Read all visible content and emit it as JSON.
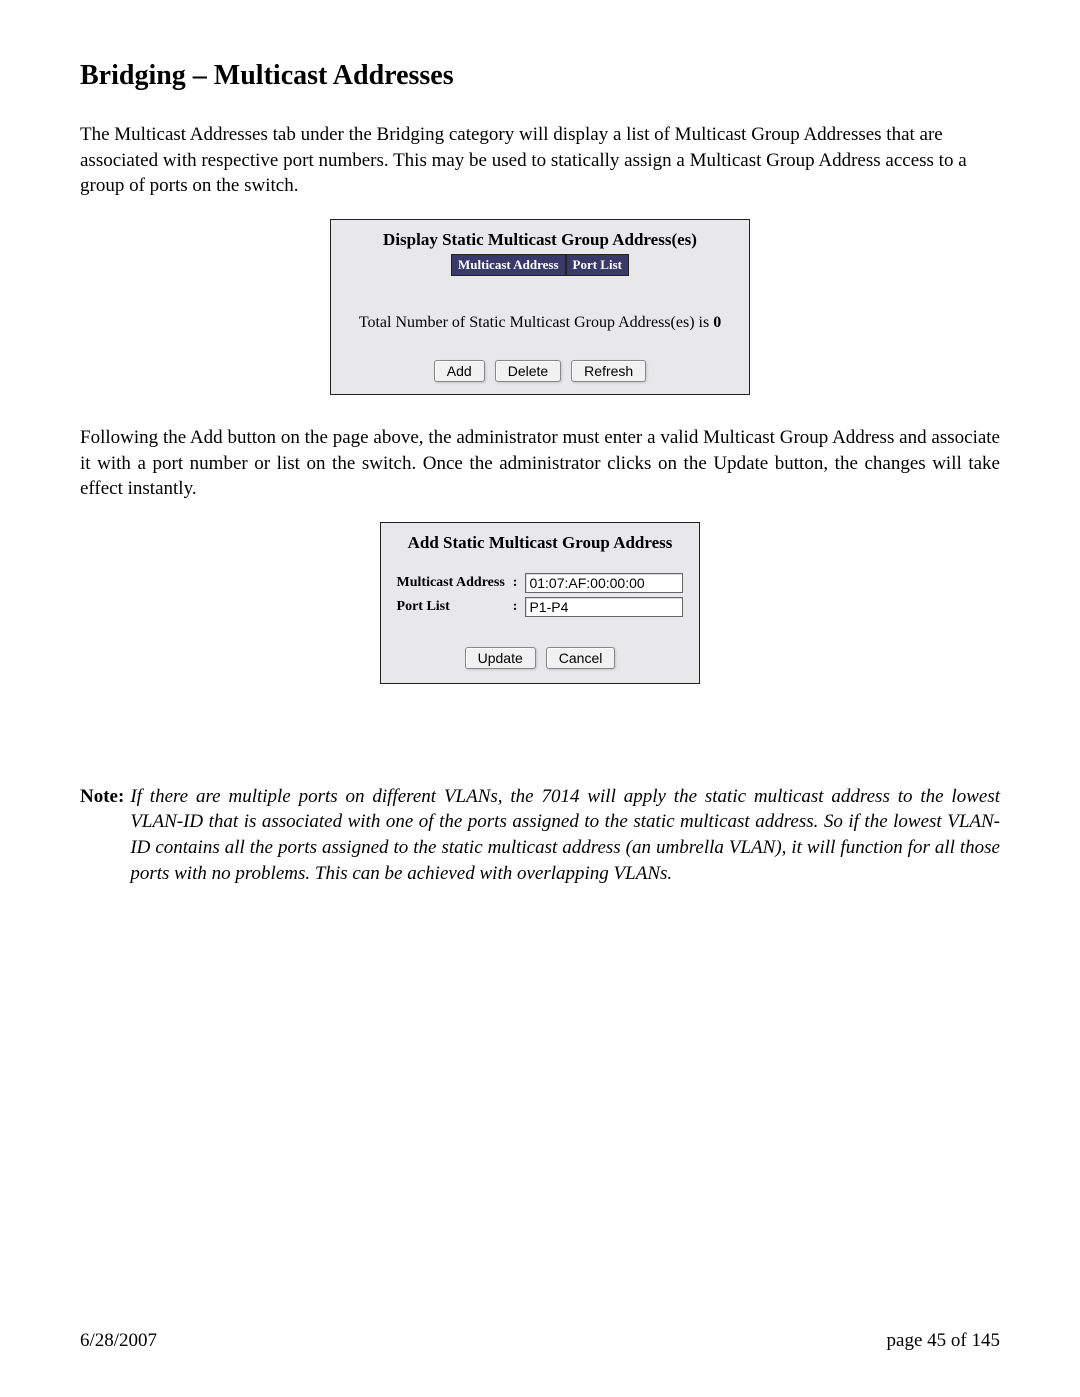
{
  "title": "Bridging – Multicast Addresses",
  "para1": "The Multicast Addresses tab under the Bridging category will display a list of Multicast Group Addresses that are associated with respective port numbers.  This may be used to statically assign a Multicast Group Address access to a group of ports on the switch.",
  "panel1": {
    "title": "Display Static Multicast Group Address(es)",
    "col1": "Multicast Address",
    "col2": "Port List",
    "total_prefix": "Total Number of Static Multicast Group Address(es) is ",
    "total_value": "0",
    "add": "Add",
    "delete": "Delete",
    "refresh": "Refresh"
  },
  "para2": "Following the Add button on the page above, the administrator must enter a valid Multicast Group Address and associate it with a port number or list on the switch.  Once the administrator clicks on the Update button, the changes will take effect instantly.",
  "panel2": {
    "title": "Add Static Multicast Group Address",
    "field1_label": "Multicast Address",
    "field1_value": "01:07:AF:00:00:00",
    "field2_label": "Port List",
    "field2_value": "P1-P4",
    "colon": ":",
    "update": "Update",
    "cancel": "Cancel"
  },
  "note": {
    "label": "Note:",
    "text": "If there are multiple ports on different VLANs, the 7014 will apply the static multicast address to the lowest VLAN-ID that is associated with one of the ports assigned to the static multicast address.  So if the lowest VLAN-ID contains all the ports assigned to the static multicast address (an umbrella VLAN), it will function for all those ports with no problems.  This can be achieved with overlapping VLANs."
  },
  "footer": {
    "date": "6/28/2007",
    "page": "page 45 of 145"
  }
}
